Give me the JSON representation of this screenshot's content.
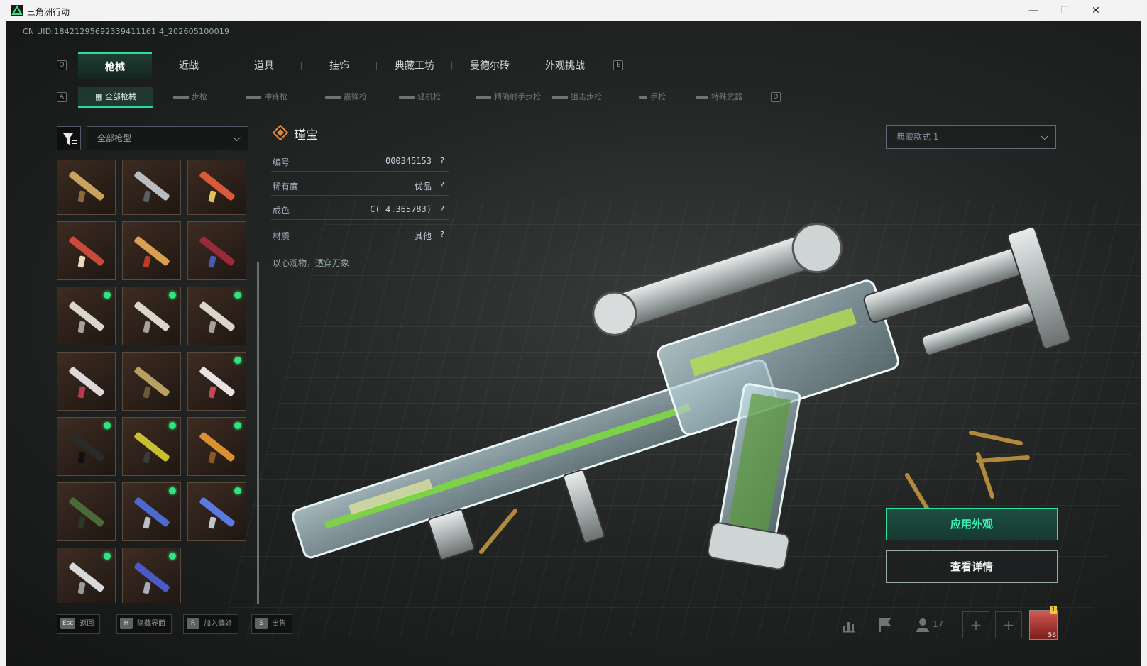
{
  "window": {
    "title": "三角洲行动",
    "minimize": "—",
    "maximize": "☐",
    "close": "✕"
  },
  "uid": "CN UID:18421295692339411161 4_202605100019",
  "main_tabs": {
    "prev_key": "Q",
    "next_key": "E",
    "items": [
      "枪械",
      "近战",
      "道具",
      "挂饰",
      "典藏工坊",
      "曼德尔砖",
      "外观挑战"
    ],
    "active_index": 0
  },
  "sub_tabs": {
    "prev_key": "A",
    "next_key": "D",
    "items": [
      "全部枪械",
      "步枪",
      "冲锋枪",
      "霰弹枪",
      "轻机枪",
      "精确射手步枪",
      "狙击步枪",
      "手枪",
      "特殊武器"
    ],
    "active_index": 0
  },
  "filter": {
    "placeholder": "全部枪型",
    "chevron": "⌵"
  },
  "inventory": {
    "cells": [
      {
        "gun": "#c9a35e",
        "acc": "#8a6a3a",
        "new": false
      },
      {
        "gun": "#b9bcc0",
        "acc": "#5a5e62",
        "new": false
      },
      {
        "gun": "#d85a3a",
        "acc": "#e0c060",
        "new": false
      },
      {
        "gun": "#c84a3a",
        "acc": "#e8d8c0",
        "new": false
      },
      {
        "gun": "#d8a050",
        "acc": "#c03a2a",
        "new": false
      },
      {
        "gun": "#9a2a3a",
        "acc": "#4a5ab0",
        "new": false
      },
      {
        "gun": "#dcd6c8",
        "acc": "#a8a296",
        "new": true
      },
      {
        "gun": "#dcd6c8",
        "acc": "#a8a296",
        "new": true
      },
      {
        "gun": "#dcd6c8",
        "acc": "#a8a296",
        "new": true
      },
      {
        "gun": "#e0d8d8",
        "acc": "#b83a4a",
        "new": false
      },
      {
        "gun": "#b8a060",
        "acc": "#6a5a3a",
        "new": false
      },
      {
        "gun": "#e8e4e4",
        "acc": "#c04a5a",
        "new": true
      },
      {
        "gun": "#2a2a2a",
        "acc": "#111111",
        "new": true
      },
      {
        "gun": "#c8c030",
        "acc": "#3a3a3a",
        "new": true
      },
      {
        "gun": "#d89030",
        "acc": "#8a5a20",
        "new": true
      },
      {
        "gun": "#4a6a3a",
        "acc": "#2a3a2a",
        "new": false
      },
      {
        "gun": "#4a6ad0",
        "acc": "#bcc0c8",
        "new": true
      },
      {
        "gun": "#5a7ae0",
        "acc": "#c0c4cc",
        "new": true
      },
      {
        "gun": "#d8d8d8",
        "acc": "#9a9a9a",
        "new": true
      },
      {
        "gun": "#4a5ac8",
        "acc": "#a8acb8",
        "new": true
      }
    ]
  },
  "detail": {
    "name": "瑾宝",
    "rows": [
      {
        "label": "编号",
        "value": "000345153",
        "help": "?"
      },
      {
        "label": "稀有度",
        "value": "优品",
        "help": "?"
      },
      {
        "label": "成色",
        "value": "C( 4.365783)",
        "help": "?"
      },
      {
        "label": "材质",
        "value": "其他",
        "help": "?"
      }
    ],
    "description": "以心观物，透穿万象"
  },
  "style_select": {
    "value": "典藏款式 1",
    "chevron": "⌵"
  },
  "actions": {
    "apply": "应用外观",
    "details": "查看详情"
  },
  "hotkeys": [
    {
      "key": "Esc",
      "label": "返回"
    },
    {
      "key": "H",
      "label": "隐藏界面"
    },
    {
      "key": "R",
      "label": "加入偏好"
    },
    {
      "key": "S",
      "label": "出售"
    }
  ],
  "status": {
    "stats_icon": "bar-chart-icon",
    "flag_icon": "flag-icon",
    "friends_count": "17",
    "slot_plus": "+",
    "avatar_level": "56",
    "avatar_badge": "1"
  },
  "colors": {
    "accent": "#2ee0a0",
    "new_dot": "#2ee67f",
    "background": "#1e2020"
  }
}
